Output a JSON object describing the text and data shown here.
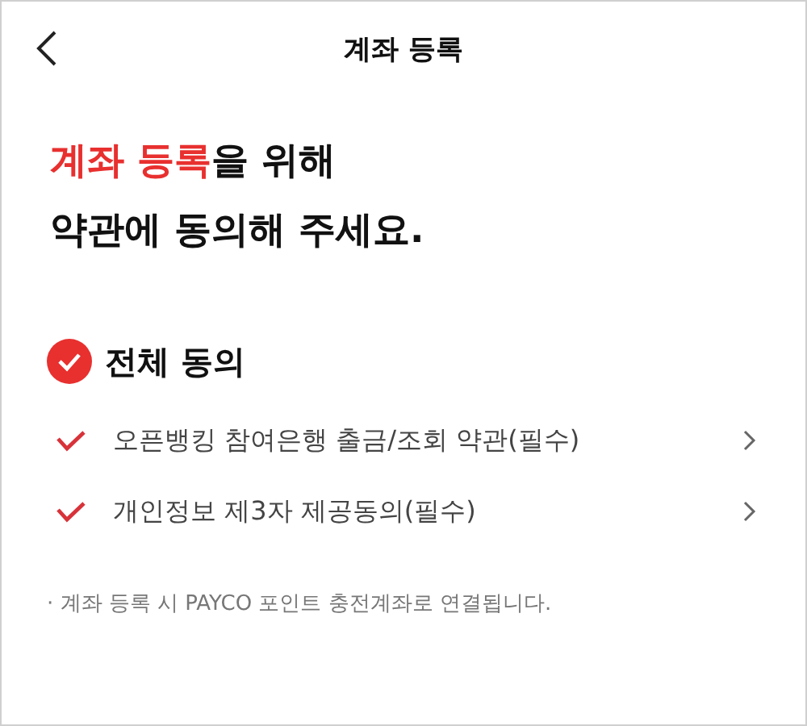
{
  "header": {
    "title": "계좌 등록"
  },
  "headline": {
    "lines": [
      [
        {
          "text": "계좌 등록",
          "highlight": true
        },
        {
          "text": "을 위해",
          "highlight": false
        }
      ],
      [
        {
          "text": "약관에 동의해 주세요.",
          "highlight": false
        }
      ]
    ]
  },
  "agree_all": {
    "label": "전체 동의",
    "checked": true
  },
  "terms": [
    {
      "label": "오픈뱅킹 참여은행 출금/조회 약관(필수)",
      "checked": true
    },
    {
      "label": "개인정보 제3자 제공동의(필수)",
      "checked": true
    }
  ],
  "note": "· 계좌 등록 시 PAYCO 포인트 충전계좌로 연결됩니다."
}
